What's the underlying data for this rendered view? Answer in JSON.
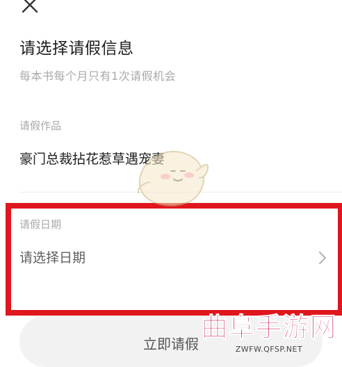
{
  "header": {
    "close_icon": "close-icon",
    "title": "请选择请假信息",
    "subtitle": "每本书每个月只有1次请假机会"
  },
  "work": {
    "label": "请假作品",
    "value": "豪门总裁拈花惹草遇宠妻"
  },
  "date": {
    "label": "请假日期",
    "placeholder": "请选择日期",
    "chevron_icon": "chevron-right-icon"
  },
  "submit": {
    "label": "立即请假"
  },
  "watermark": {
    "name": "曲阜手游网",
    "url": "ZWFW.QFSP.NET"
  },
  "colors": {
    "highlight": "#e0161e",
    "watermark_name": "#c7185a",
    "muted_text": "#a9a9a9",
    "button_bg": "#f2f2f2"
  }
}
